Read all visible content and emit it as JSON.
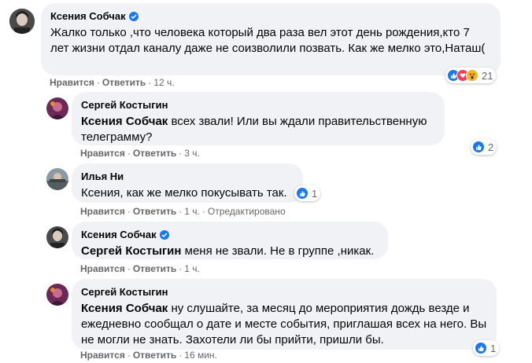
{
  "comments": [
    {
      "author": "Ксения Собчак",
      "verified": true,
      "text": "Жалко только ,что человека который два раза вел этот день рождения,кто 7 лет жизни отдал каналу даже не соизволили позвать. Как же мелко это,Наташ(",
      "like_label": "Нравится",
      "reply_label": "Ответить",
      "time": "12 ч.",
      "reactions": [
        "like",
        "love",
        "wow"
      ],
      "reaction_count": "21"
    },
    {
      "author": "Сергей Костыгин",
      "mention": "Ксения Собчак",
      "text": "всех звали! Или вы ждали правительственную телеграмму?",
      "like_label": "Нравится",
      "reply_label": "Ответить",
      "time": "3 ч.",
      "reactions": [
        "like"
      ],
      "reaction_count": "2"
    },
    {
      "author": "Илья Ни",
      "text": "Ксения, как же мелко покусывать так.",
      "like_label": "Нравится",
      "reply_label": "Ответить",
      "time": "1 ч.",
      "edited": "Отредактировано",
      "reactions": [
        "like"
      ],
      "reaction_count": "1"
    },
    {
      "author": "Ксения Собчак",
      "verified": true,
      "mention": "Сергей Костыгин",
      "text": "меня не звали. Не в группе ,никак.",
      "like_label": "Нравится",
      "reply_label": "Ответить",
      "time": "1 ч."
    },
    {
      "author": "Сергей Костыгин",
      "mention": "Ксения Собчак",
      "text": "ну слушайте, за месяц до мероприятия дождь везде и ежедневно сообщал о дате и месте события, приглашая всех на него. Вы не могли не знать. Захотели ли бы прийти, пришли бы.",
      "like_label": "Нравится",
      "reply_label": "Ответить",
      "time": "16 мин.",
      "reactions": [
        "like"
      ],
      "reaction_count": "1"
    }
  ],
  "colors": {
    "bubble": "#f0f2f5",
    "meta_text": "#65676b",
    "like_blue": "#1877f2",
    "love_red": "#f33e58",
    "wow_yellow": "#f7b125"
  }
}
